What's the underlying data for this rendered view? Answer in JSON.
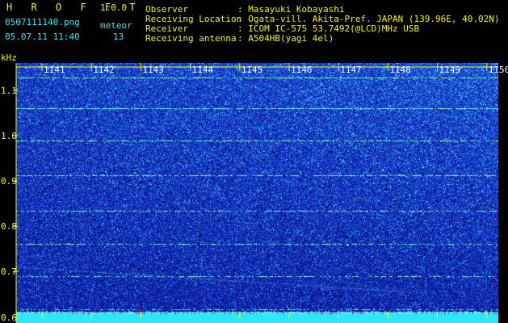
{
  "header": {
    "app_name": "H R O F F T",
    "version": "1.0.0",
    "filename": "0507111140.png",
    "mode": "meteor",
    "datetime": "05.07.11 11:40",
    "count": "13",
    "info_labels": {
      "observer": "Observer",
      "location": "Receiving Location",
      "receiver": "Receiver",
      "antenna": "Receiving antenna"
    },
    "info_values": {
      "observer": ": Masayuki Kobayashi",
      "location": ": Ogata-vill. Akita-Pref. JAPAN (139.96E, 40.02N)",
      "receiver": ": ICOM IC-575 53.7492(@LCD)MHz USB",
      "antenna": ": A504HB(yagi 4el)"
    }
  },
  "spectrogram": {
    "y_unit": "kHz",
    "y_ticks": [
      "1.1",
      "1.0",
      "0.9",
      "0.8",
      "0.7",
      "0.6"
    ],
    "y_tick_values": [
      1.1,
      1.0,
      0.9,
      0.8,
      0.7,
      0.6
    ],
    "y_range": [
      0.587,
      1.16
    ],
    "time_labels": [
      "1141",
      "1142",
      "1143",
      "1144",
      "1145",
      "1146",
      "1147",
      "1148",
      "1149",
      "1150"
    ],
    "colors": {
      "background": "#0a1490",
      "noise": "#1b4fd8",
      "signal": "#2ee6ff",
      "hot": "#c8ff66",
      "marker": "#f5f500"
    }
  }
}
